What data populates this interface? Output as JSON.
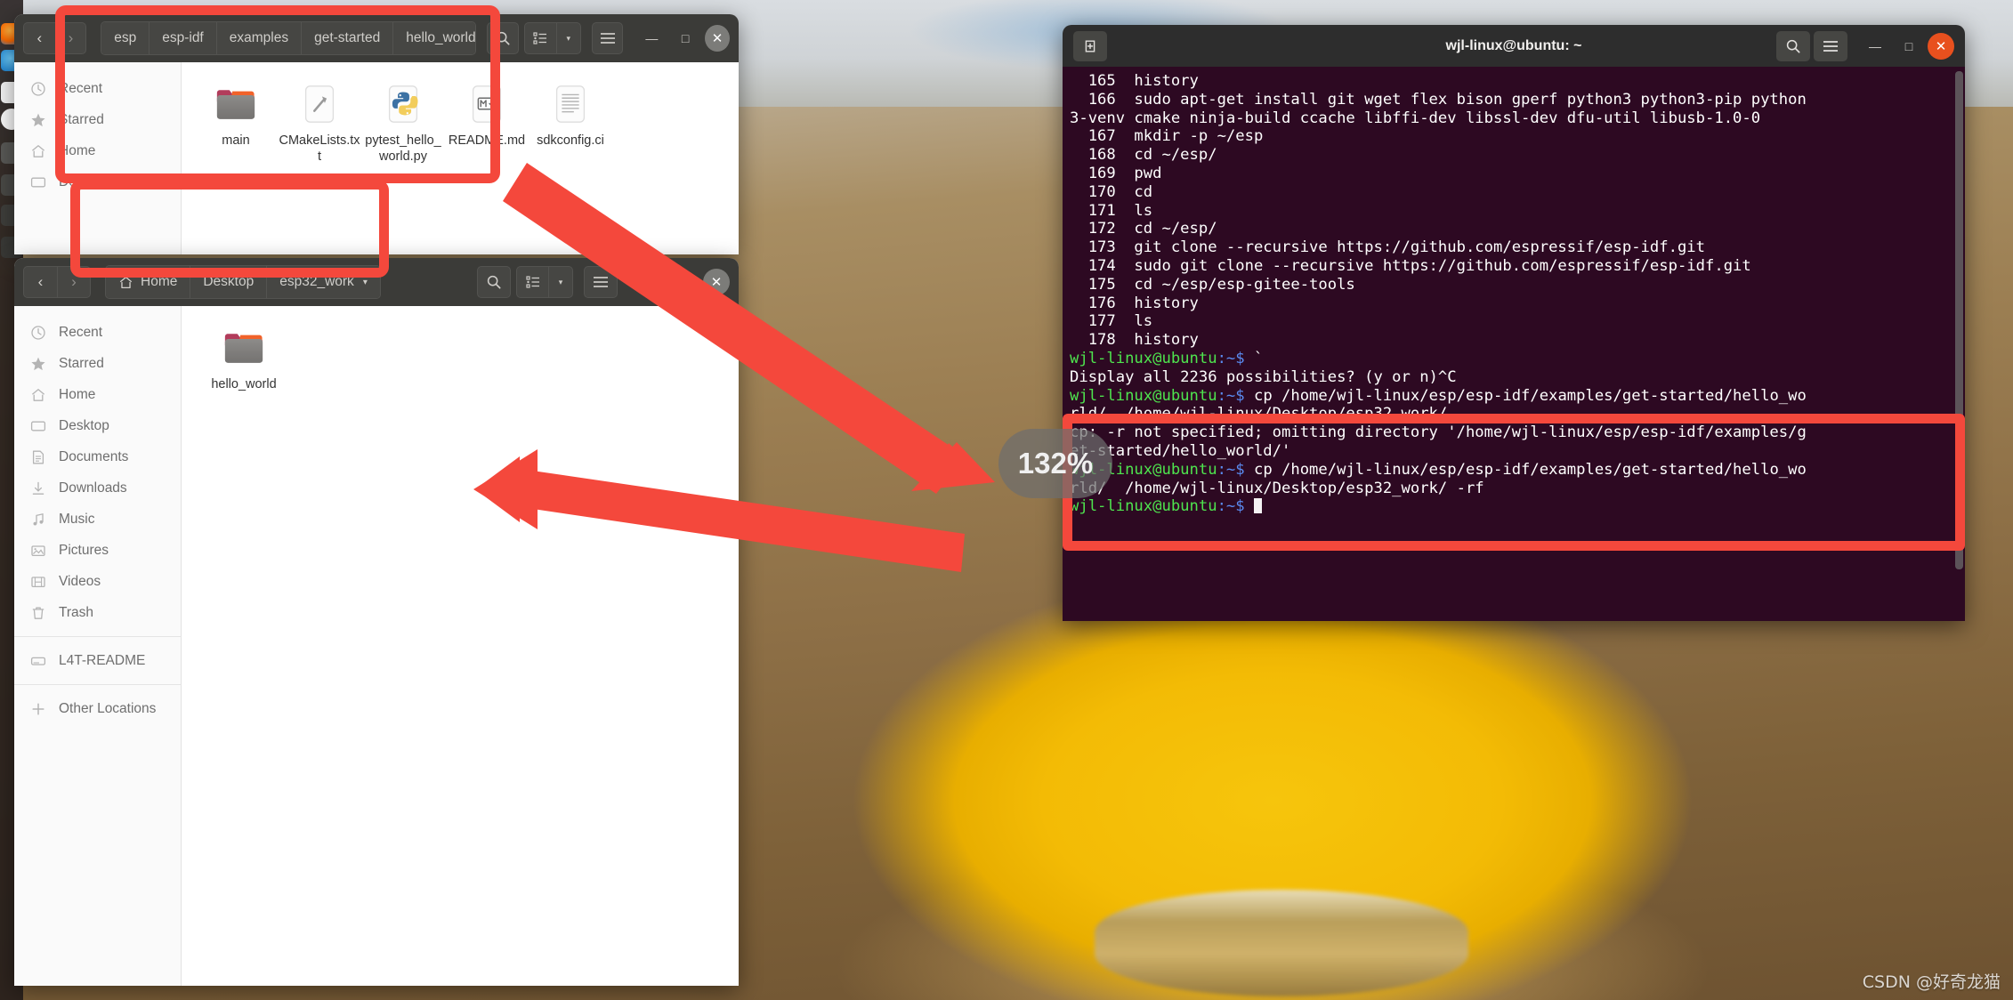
{
  "desktop": {
    "watermark": "CSDN @好奇龙猫",
    "dock_icons": [
      "firefox-icon",
      "thunderbird-icon",
      "files-icon",
      "rhythmbox-icon",
      "libreoffice-icon",
      "software-icon",
      "help-icon",
      "trash-icon"
    ]
  },
  "annotations": {
    "zoom_badge": "132%",
    "highlight_color": "#f4483c",
    "arrows": [
      {
        "name": "arrow-to-terminal",
        "direction": "down-right"
      },
      {
        "name": "arrow-to-esp32-work",
        "direction": "left"
      }
    ],
    "boxes": [
      {
        "name": "highlight-box-hello-world-window"
      },
      {
        "name": "highlight-box-esp32-work-window"
      },
      {
        "name": "highlight-box-terminal-commands"
      }
    ]
  },
  "window_hello_world": {
    "nav": {
      "back": "‹",
      "forward": "›"
    },
    "breadcrumbs": [
      {
        "label": "esp",
        "icon": null
      },
      {
        "label": "esp-idf",
        "icon": null
      },
      {
        "label": "examples",
        "icon": null
      },
      {
        "label": "get-started",
        "icon": null
      },
      {
        "label": "hello_world",
        "icon": null,
        "caret": "▾"
      }
    ],
    "toolbar": {
      "search": "search-icon",
      "view_list": "list-view-icon",
      "view_caret": "▾",
      "menu": "hamburger-menu-icon",
      "minimize": "—",
      "maximize": "□",
      "close": "✕"
    },
    "sidebar": [
      {
        "label": "Recent",
        "icon": "clock-icon"
      },
      {
        "label": "Starred",
        "icon": "star-icon"
      },
      {
        "label": "Home",
        "icon": "home-icon"
      },
      {
        "label": "Desktop",
        "icon": "desktop-icon"
      }
    ],
    "files": [
      {
        "name": "main",
        "icon": "folder-icon"
      },
      {
        "name": "CMakeLists.txt",
        "icon": "cmake-file-icon"
      },
      {
        "name": "pytest_hello_world.py",
        "icon": "python-file-icon"
      },
      {
        "name": "README.md",
        "icon": "markdown-file-icon"
      },
      {
        "name": "sdkconfig.ci",
        "icon": "text-file-icon"
      }
    ]
  },
  "window_esp32_work": {
    "nav": {
      "back": "‹",
      "forward": "›"
    },
    "breadcrumbs": [
      {
        "label": "Home",
        "icon": "home-icon"
      },
      {
        "label": "Desktop",
        "icon": null
      },
      {
        "label": "esp32_work",
        "icon": null,
        "caret": "▾"
      }
    ],
    "toolbar": {
      "search": "search-icon",
      "view_list": "list-view-icon",
      "view_caret": "▾",
      "menu": "hamburger-menu-icon",
      "minimize": "—",
      "maximize": "□",
      "close": "✕"
    },
    "sidebar": [
      {
        "label": "Recent",
        "icon": "clock-icon"
      },
      {
        "label": "Starred",
        "icon": "star-icon"
      },
      {
        "label": "Home",
        "icon": "home-icon"
      },
      {
        "label": "Desktop",
        "icon": "desktop-icon"
      },
      {
        "label": "Documents",
        "icon": "documents-icon"
      },
      {
        "label": "Downloads",
        "icon": "download-icon"
      },
      {
        "label": "Music",
        "icon": "music-icon"
      },
      {
        "label": "Pictures",
        "icon": "pictures-icon"
      },
      {
        "label": "Videos",
        "icon": "videos-icon"
      },
      {
        "label": "Trash",
        "icon": "trash-icon"
      }
    ],
    "sidebar_devices": [
      {
        "label": "L4T-README",
        "icon": "drive-icon"
      }
    ],
    "sidebar_other": {
      "label": "Other Locations",
      "icon": "plus-icon"
    },
    "files": [
      {
        "name": "hello_world",
        "icon": "folder-icon"
      }
    ]
  },
  "terminal": {
    "title": "wjl-linux@ubuntu: ~",
    "new_tab_icon": "new-tab-icon",
    "search_icon": "search-icon",
    "menu_icon": "hamburger-menu-icon",
    "minimize": "—",
    "maximize": "□",
    "close": "✕",
    "lines": [
      {
        "type": "plain",
        "text": "  165  history"
      },
      {
        "type": "plain",
        "text": "  166  sudo apt-get install git wget flex bison gperf python3 python3-pip python"
      },
      {
        "type": "plain",
        "text": "3-venv cmake ninja-build ccache libffi-dev libssl-dev dfu-util libusb-1.0-0"
      },
      {
        "type": "plain",
        "text": "  167  mkdir -p ~/esp"
      },
      {
        "type": "plain",
        "text": "  168  cd ~/esp/"
      },
      {
        "type": "plain",
        "text": "  169  pwd"
      },
      {
        "type": "plain",
        "text": "  170  cd"
      },
      {
        "type": "plain",
        "text": "  171  ls"
      },
      {
        "type": "plain",
        "text": "  172  cd ~/esp/"
      },
      {
        "type": "plain",
        "text": "  173  git clone --recursive https://github.com/espressif/esp-idf.git"
      },
      {
        "type": "plain",
        "text": "  174  sudo git clone --recursive https://github.com/espressif/esp-idf.git"
      },
      {
        "type": "plain",
        "text": "  175  cd ~/esp/esp-gitee-tools"
      },
      {
        "type": "plain",
        "text": "  176  history"
      },
      {
        "type": "plain",
        "text": "  177  ls"
      },
      {
        "type": "plain",
        "text": "  178  history"
      },
      {
        "type": "prompt",
        "user": "wjl-linux@ubuntu",
        "path": ":~$",
        "cmd": " `"
      },
      {
        "type": "plain",
        "text": "Display all 2236 possibilities? (y or n)^C"
      },
      {
        "type": "prompt",
        "user": "wjl-linux@ubuntu",
        "path": ":~$",
        "cmd": " cp /home/wjl-linux/esp/esp-idf/examples/get-started/hello_wo"
      },
      {
        "type": "plain",
        "text": "rld/  /home/wjl-linux/Desktop/esp32_work/"
      },
      {
        "type": "plain",
        "text": "cp: -r not specified; omitting directory '/home/wjl-linux/esp/esp-idf/examples/g"
      },
      {
        "type": "plain",
        "text": "et-started/hello_world/'"
      },
      {
        "type": "prompt",
        "user": "wjl-linux@ubuntu",
        "path": ":~$",
        "cmd": " cp /home/wjl-linux/esp/esp-idf/examples/get-started/hello_wo"
      },
      {
        "type": "plain",
        "text": "rld/  /home/wjl-linux/Desktop/esp32_work/ -rf"
      },
      {
        "type": "prompt-cursor",
        "user": "wjl-linux@ubuntu",
        "path": ":~$",
        "cmd": " "
      }
    ]
  }
}
